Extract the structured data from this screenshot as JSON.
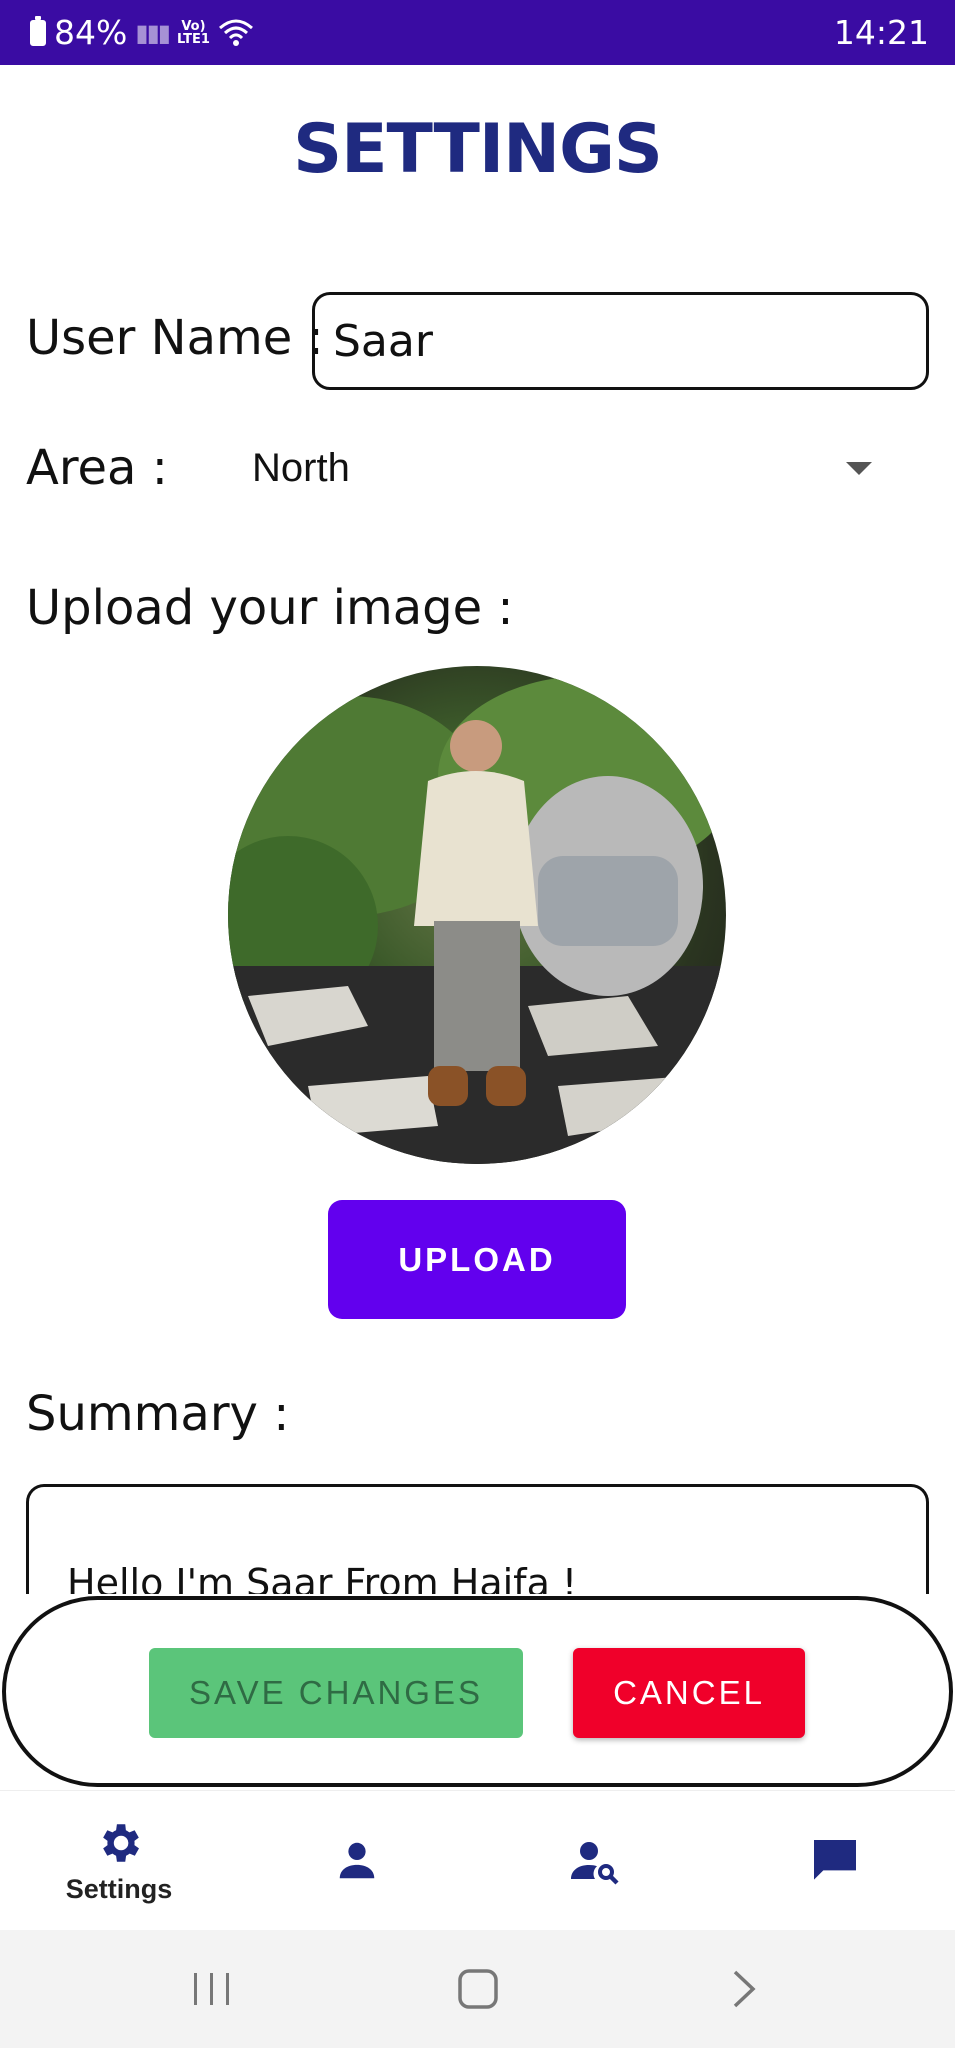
{
  "status_bar": {
    "battery": "84%",
    "time": "14:21"
  },
  "page": {
    "title": "SETTINGS",
    "user_name_label": "User Name :",
    "user_name_value": "Saar",
    "area_label": "Area :",
    "area_value": "North",
    "upload_label": "Upload your image :",
    "upload_button": "UPLOAD",
    "summary_label": "Summary :",
    "summary_text": "Hello I'm Saar From Haifa !"
  },
  "actions": {
    "save": "SAVE CHANGES",
    "cancel": "CANCEL"
  },
  "bottom_nav": {
    "settings_label": "Settings"
  },
  "colors": {
    "status_bar": "#3a0ca3",
    "title": "#1f2a80",
    "upload_button": "#6200ee",
    "save_button": "#5bc57a",
    "cancel_button": "#f0002a",
    "nav_icon": "#1f2a80"
  }
}
